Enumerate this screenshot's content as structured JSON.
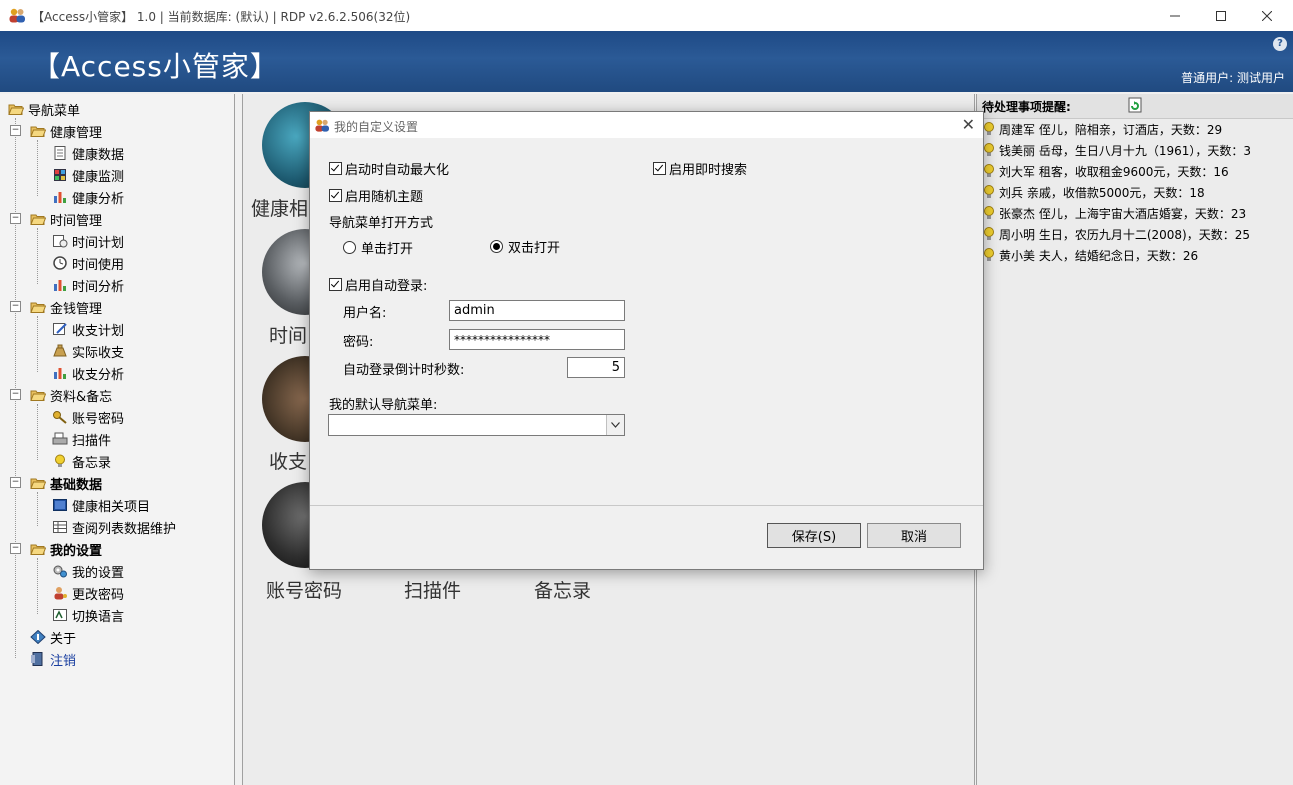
{
  "window": {
    "title": "【Access小管家】 1.0 | 当前数据库: (默认) | RDP v2.6.2.506(32位)"
  },
  "banner": {
    "brand": "【Access小管家】",
    "user": "普通用户: 测试用户"
  },
  "nav": {
    "root": "导航菜单",
    "groups": [
      {
        "label": "健康管理",
        "items": [
          "健康数据",
          "健康监测",
          "健康分析"
        ]
      },
      {
        "label": "时间管理",
        "items": [
          "时间计划",
          "时间使用",
          "时间分析"
        ]
      },
      {
        "label": "金钱管理",
        "items": [
          "收支计划",
          "实际收支",
          "收支分析"
        ]
      },
      {
        "label": "资料&备忘",
        "items": [
          "账号密码",
          "扫描件",
          "备忘录"
        ]
      },
      {
        "label": "基础数据",
        "items": [
          "健康相关项目",
          "查阅列表数据维护"
        ]
      },
      {
        "label": "我的设置",
        "items": [
          "我的设置",
          "更改密码",
          "切换语言"
        ]
      }
    ],
    "about": "关于",
    "logout": "注销"
  },
  "tiles": {
    "row1": "健康相",
    "row2": "时间",
    "row3": "收支",
    "row4": [
      "账号密码",
      "扫描件",
      "备忘录"
    ]
  },
  "reminders": {
    "title": "待处理事项提醒:",
    "items": [
      "周建军 侄儿，陪相亲，订酒店，天数：29",
      "钱美丽 岳母，生日八月十九（1961），天数：3",
      "刘大军 租客，收取租金9600元，天数：16",
      "刘兵 亲戚，收借款5000元，天数：18",
      "张豪杰 侄儿，上海宇宙大酒店婚宴，天数：23",
      "周小明 生日，农历九月十二(2008)，天数：25",
      "黄小美 夫人，结婚纪念日，天数：26"
    ]
  },
  "dialog": {
    "title": "我的自定义设置",
    "maximize_on_start": "启动时自动最大化",
    "instant_search": "启用即时搜索",
    "random_theme": "启用随机主题",
    "nav_open_mode_label": "导航菜单打开方式",
    "single_click": "单击打开",
    "double_click": "双击打开",
    "auto_login": "启用自动登录:",
    "username_label": "用户名:",
    "username_value": "admin",
    "password_label": "密码:",
    "password_value": "****************",
    "countdown_label": "自动登录倒计时秒数:",
    "countdown_value": "5",
    "default_nav_label": "我的默认导航菜单:",
    "default_nav_value": "",
    "save": "保存(S)",
    "cancel": "取消"
  }
}
